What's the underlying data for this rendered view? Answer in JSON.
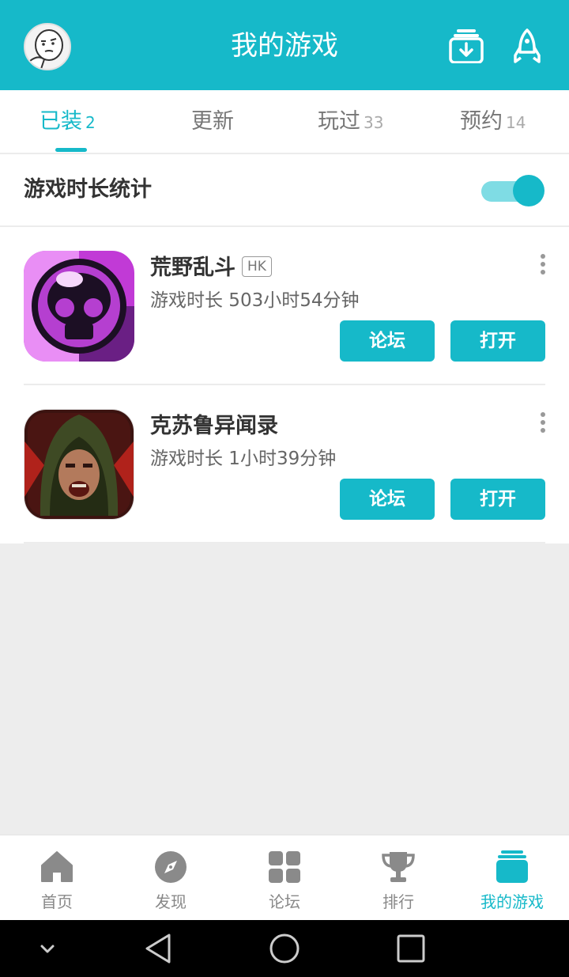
{
  "header": {
    "title": "我的游戏",
    "avatar_icon": "avatar-icon",
    "download_icon": "download-icon",
    "rocket_icon": "rocket-icon"
  },
  "tabs": [
    {
      "label": "已装",
      "count": "2",
      "active": true
    },
    {
      "label": "更新",
      "count": "",
      "active": false
    },
    {
      "label": "玩过",
      "count": "33",
      "active": false
    },
    {
      "label": "预约",
      "count": "14",
      "active": false
    }
  ],
  "stats": {
    "label": "游戏时长统计",
    "toggle_on": true
  },
  "games": [
    {
      "name": "荒野乱斗",
      "badge": "HK",
      "playtime": "游戏时长 503小时54分钟",
      "forum_label": "论坛",
      "open_label": "打开",
      "icon": "skull-icon"
    },
    {
      "name": "克苏鲁异闻录",
      "badge": "",
      "playtime": "游戏时长 1小时39分钟",
      "forum_label": "论坛",
      "open_label": "打开",
      "icon": "hooded-man-icon"
    }
  ],
  "bottom_nav": [
    {
      "label": "首页",
      "icon": "home-icon",
      "active": false
    },
    {
      "label": "发现",
      "icon": "compass-icon",
      "active": false
    },
    {
      "label": "论坛",
      "icon": "grid-icon",
      "active": false
    },
    {
      "label": "排行",
      "icon": "trophy-icon",
      "active": false
    },
    {
      "label": "我的游戏",
      "icon": "stack-icon",
      "active": true
    }
  ],
  "colors": {
    "accent": "#16b9c9",
    "background": "#ededed"
  }
}
